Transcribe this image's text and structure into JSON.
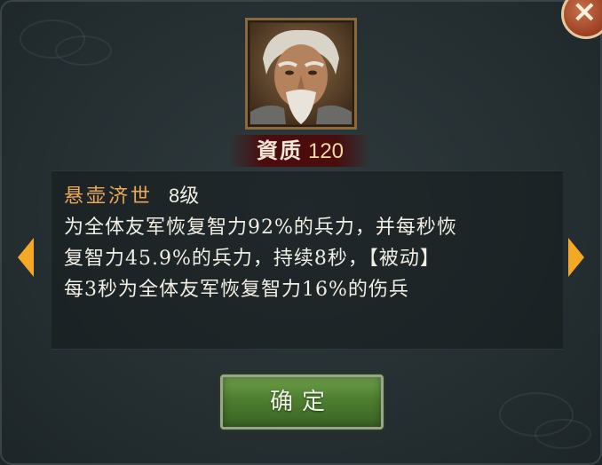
{
  "close_button": {
    "label": "×"
  },
  "general": {
    "aptitude_label": "資质",
    "aptitude_value": "120"
  },
  "skill": {
    "name": "悬壶济世",
    "level": "8级",
    "description_lines": [
      "为全体友军恢复智力92%的兵力，并每秒恢",
      "复智力45.9%的兵力，持续8秒，【被动】",
      "每3秒为全体友军恢复智力16%的伤兵"
    ]
  },
  "confirm_button": {
    "label": "确定"
  },
  "colors": {
    "accent_orange": "#f3a926",
    "skill_name": "#e9a85a",
    "button_green": "#4d7e30"
  }
}
